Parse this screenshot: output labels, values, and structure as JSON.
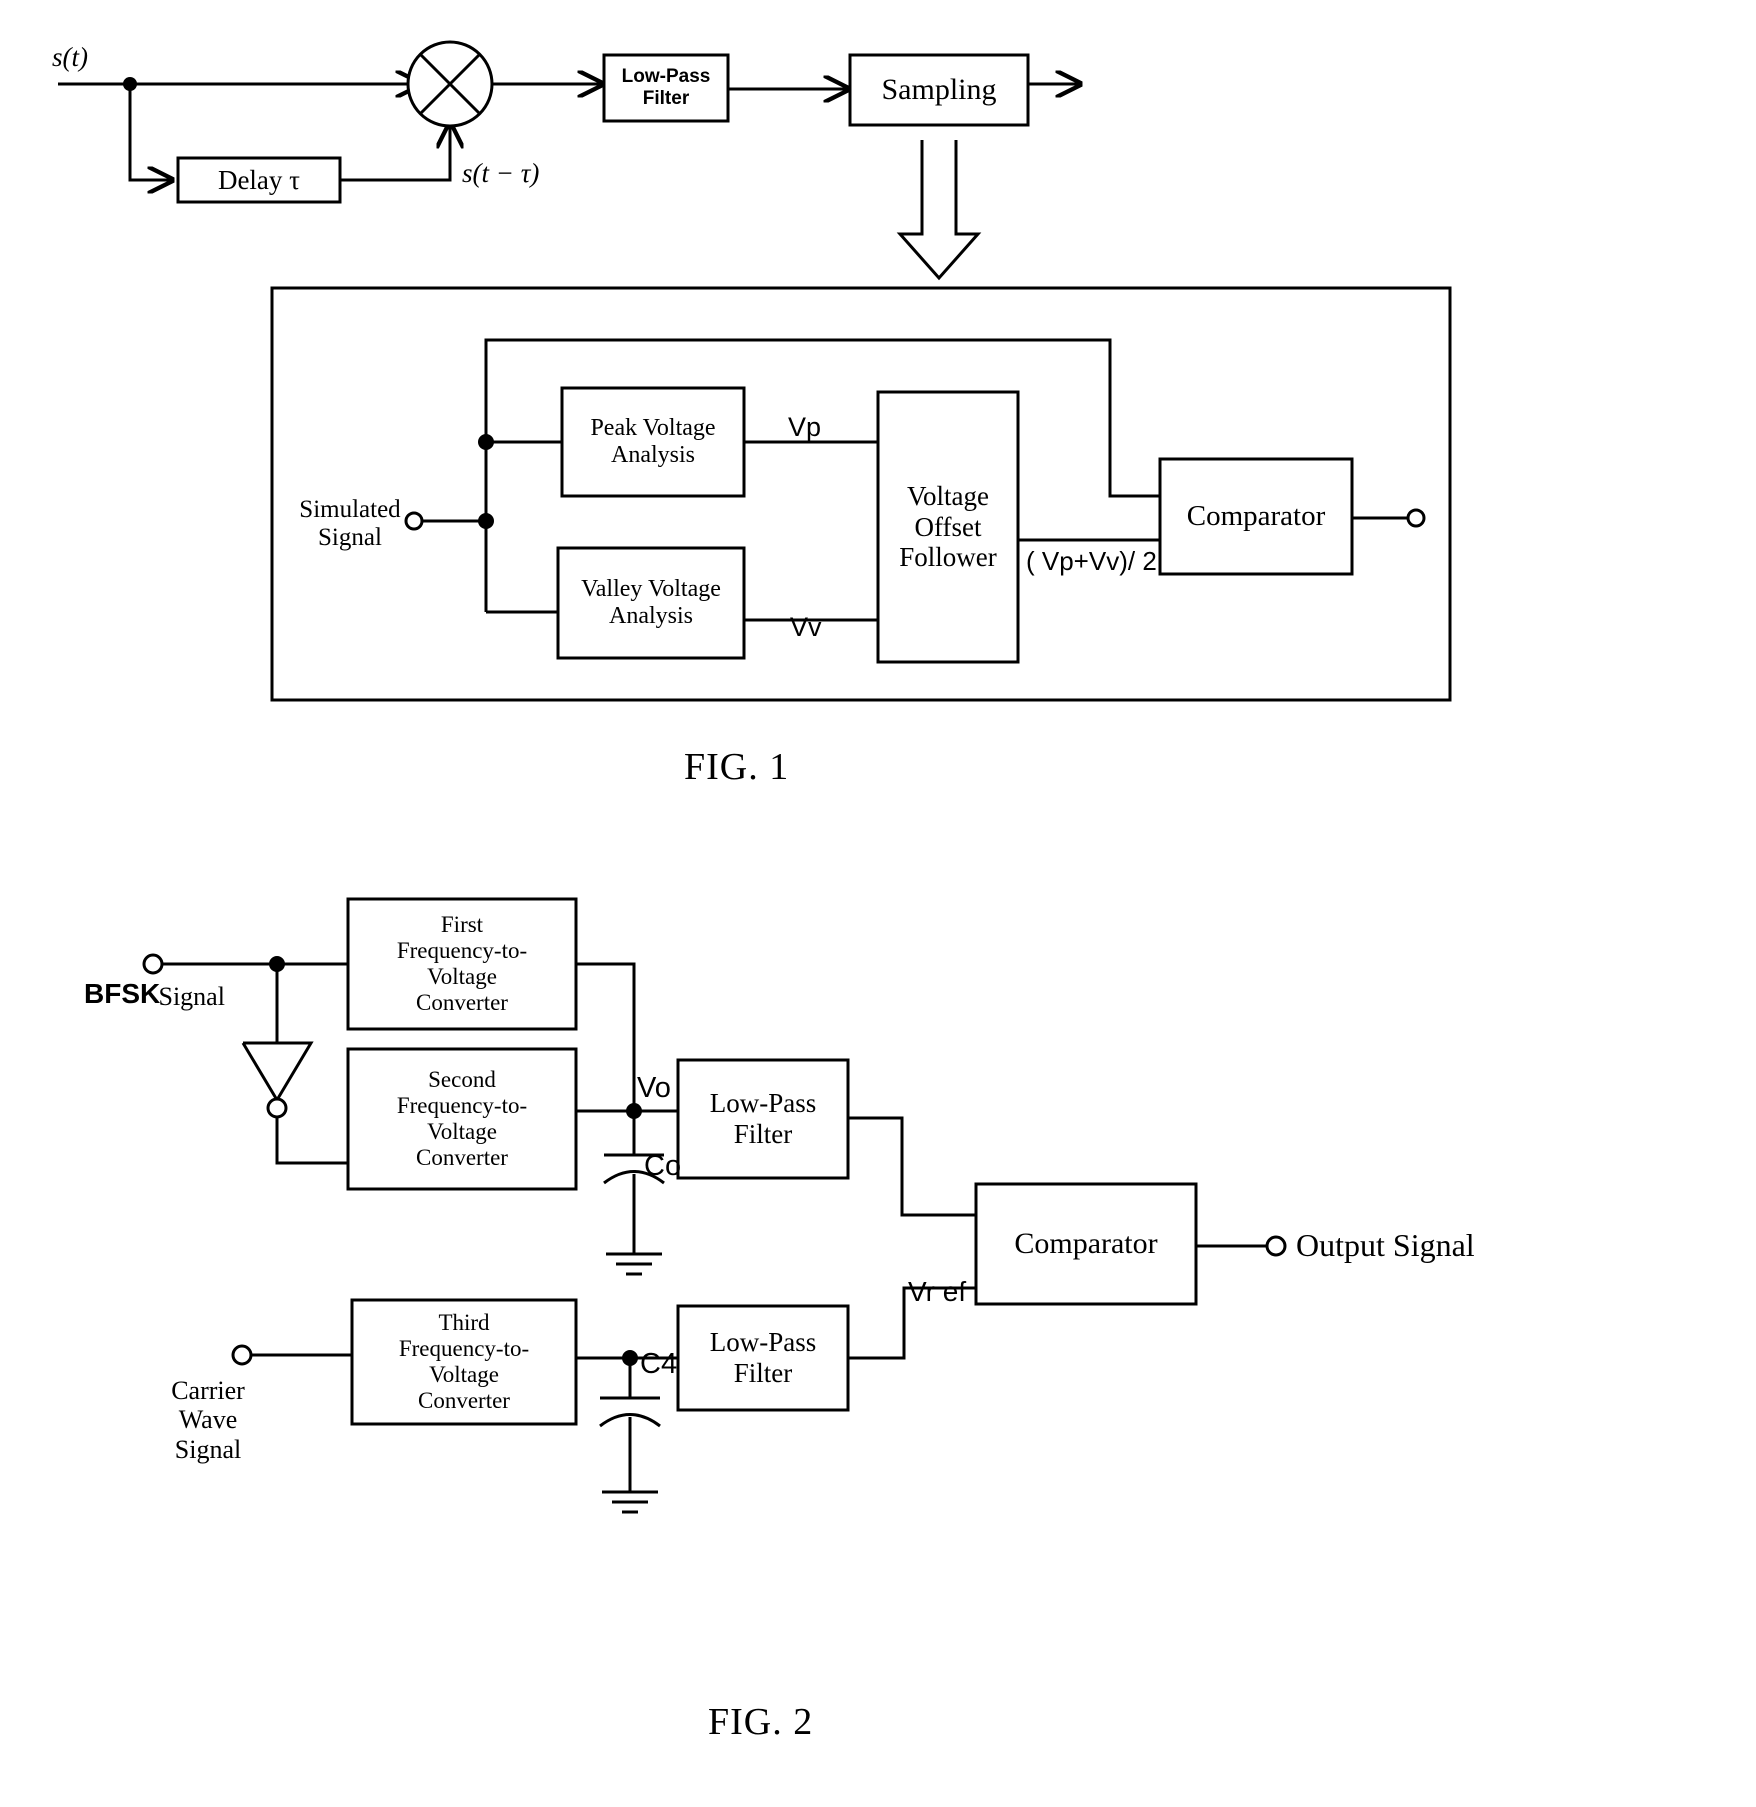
{
  "figures": [
    {
      "id": "fig1",
      "caption": "FIG. 1",
      "signals": {
        "input": "s(t)",
        "delayed": "s(t − τ)"
      },
      "blocks": {
        "delay": "Delay  τ",
        "lowpass": "Low-Pass\nFilter",
        "sampling": "Sampling",
        "peak": "Peak Voltage\nAnalysis",
        "valley": "Valley Voltage\nAnalysis",
        "offset": "Voltage\nOffset\nFollower",
        "comparator": "Comparator"
      },
      "labels": {
        "simulated_signal": "Simulated\nSignal",
        "vp": "Vp",
        "vv": "Vv",
        "mid": "( Vp+Vv)/ 2"
      }
    },
    {
      "id": "fig2",
      "caption": "FIG. 2",
      "blocks": {
        "first_fvc": "First\nFrequency-to-\nVoltage\nConverter",
        "second_fvc": "Second\nFrequency-to-\nVoltage\nConverter",
        "third_fvc": "Third\nFrequency-to-\nVoltage\nConverter",
        "lpf_top": "Low-Pass\nFilter",
        "lpf_bottom": "Low-Pass\nFilter",
        "comparator": "Comparator"
      },
      "labels": {
        "bfsk_bold": "BFSK",
        "bfsk_rest": " Signal",
        "carrier": "Carrier\nWave\nSignal",
        "vo": "Vo",
        "co": "Co",
        "c4": "C4",
        "vref": "Vr ef",
        "output": "Output Signal"
      }
    }
  ],
  "colors": {
    "ink": "#000000",
    "paper": "#ffffff"
  }
}
